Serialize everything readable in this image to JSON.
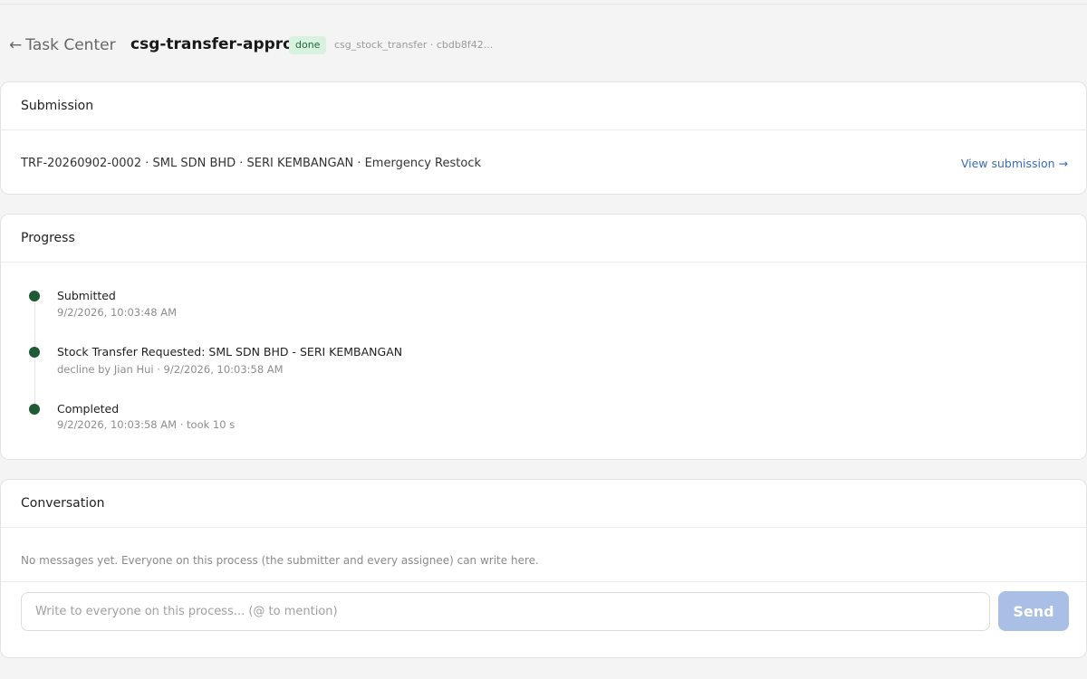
{
  "header": {
    "back_label": "Task Center",
    "title": "csg-transfer-approval",
    "status_badge": "done",
    "meta": "csg_stock_transfer · cbdb8f42..."
  },
  "submission": {
    "heading": "Submission",
    "summary": "TRF-20260902-0002 · SML SDN BHD · SERI KEMBANGAN · Emergency Restock",
    "link_label": "View submission →"
  },
  "progress": {
    "heading": "Progress",
    "steps": [
      {
        "title": "Submitted",
        "subtitle": "9/2/2026, 10:03:48 AM"
      },
      {
        "title": "Stock Transfer Requested: SML SDN BHD - SERI KEMBANGAN",
        "subtitle": "decline by Jian Hui · 9/2/2026, 10:03:58 AM"
      },
      {
        "title": "Completed",
        "subtitle": "9/2/2026, 10:03:58 AM · took 10 s"
      }
    ]
  },
  "conversation": {
    "heading": "Conversation",
    "empty_text": "No messages yet. Everyone on this process (the submitter and every assignee) can write here.",
    "input_placeholder": "Write to everyone on this process... (@ to mention)",
    "send_label": "Send"
  },
  "colors": {
    "accent_link": "#3a6cb4",
    "step_dot": "#1e5b34",
    "badge_bg": "#d8f2df",
    "send_disabled": "#a9bfe6"
  }
}
